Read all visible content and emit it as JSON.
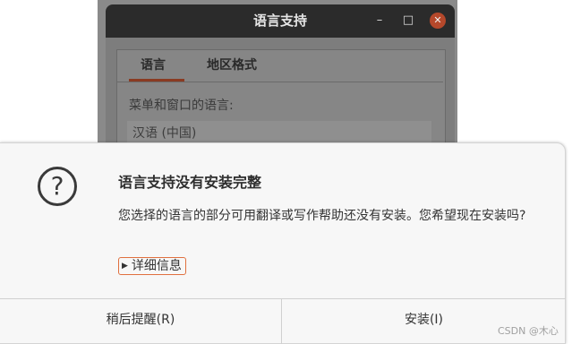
{
  "background_window": {
    "title": "语言支持",
    "tabs": [
      {
        "label": "语言",
        "active": true
      },
      {
        "label": "地区格式",
        "active": false
      }
    ],
    "language_label": "菜单和窗口的语言:",
    "language_value": "汉语 (中国)",
    "controls": {
      "minimize": "–",
      "maximize": "□",
      "close": "✕"
    }
  },
  "dialog": {
    "icon": "question-icon",
    "icon_glyph": "?",
    "title": "语言支持没有安装完整",
    "message": "您选择的语言的部分可用翻译或写作帮助还没有安装。您希望现在安装吗?",
    "details_label": "详细信息",
    "details_glyph": "▶",
    "buttons": {
      "later": "稍后提醒(R)",
      "install": "安装(I)"
    }
  },
  "watermark": "CSDN @木心",
  "colors": {
    "titlebar": "#2b2b2b",
    "close_button": "#b5482b",
    "accent": "#e0703f",
    "dialog_bg": "#f7f7f7"
  }
}
